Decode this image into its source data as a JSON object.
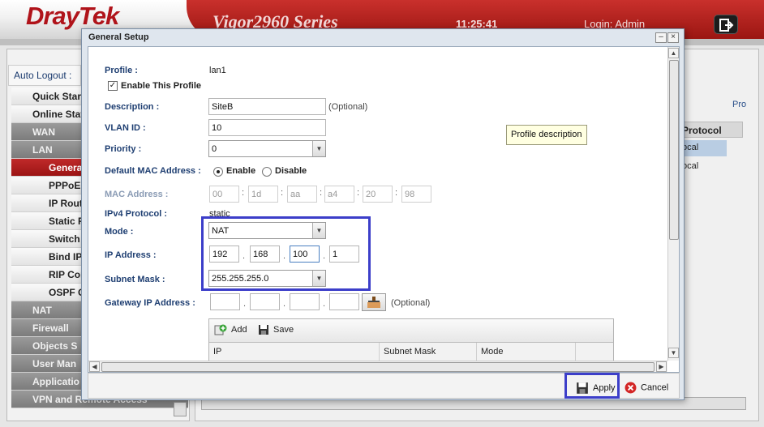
{
  "header": {
    "brand": "DrayTek",
    "model": "Vigor2960 Series",
    "time": "11:25:41",
    "login": "Login: Admin"
  },
  "sidebar": {
    "auto_logout_label": "Auto Logout :",
    "items": [
      {
        "label": "Quick Start",
        "level": 1
      },
      {
        "label": "Online Stat",
        "level": 1
      },
      {
        "label": "WAN",
        "level": 2
      },
      {
        "label": "LAN",
        "level": 2
      },
      {
        "label": "General",
        "level": 3,
        "active": true
      },
      {
        "label": "PPPoE",
        "level": 3
      },
      {
        "label": "IP Rout",
        "level": 3
      },
      {
        "label": "Static R",
        "level": 3
      },
      {
        "label": "Switch",
        "level": 3
      },
      {
        "label": "Bind IP",
        "level": 3
      },
      {
        "label": "RIP Cor",
        "level": 3
      },
      {
        "label": "OSPF C",
        "level": 3
      },
      {
        "label": "NAT",
        "level": 2
      },
      {
        "label": "Firewall",
        "level": 2
      },
      {
        "label": "Objects S",
        "level": 2
      },
      {
        "label": "User Man",
        "level": 2
      },
      {
        "label": "Applicatio",
        "level": 2
      },
      {
        "label": "VPN and Remote Access",
        "level": 2
      }
    ]
  },
  "background_table": {
    "pro_text": "Pro",
    "column": "Protocol",
    "rows": [
      "ocal",
      "ocal"
    ]
  },
  "dialog": {
    "title": "General Setup",
    "profile_label": "Profile :",
    "profile_value": "lan1",
    "enable_profile_label": "Enable This Profile",
    "enable_profile_checked": true,
    "description_label": "Description :",
    "description_value": "SiteB",
    "optional": "(Optional)",
    "vlan_label": "VLAN ID :",
    "vlan_value": "10",
    "priority_label": "Priority :",
    "priority_value": "0",
    "default_mac_label": "Default MAC Address :",
    "enable_label": "Enable",
    "disable_label": "Disable",
    "mac_label": "MAC Address :",
    "mac_octets": [
      "00",
      "1d",
      "aa",
      "a4",
      "20",
      "98"
    ],
    "ipv4_label": "IPv4 Protocol :",
    "ipv4_value": "static",
    "mode_label": "Mode :",
    "mode_value": "NAT",
    "ip_label": "IP Address :",
    "ip_octets": [
      "192",
      "168",
      "100",
      "1"
    ],
    "subnet_label": "Subnet Mask :",
    "subnet_value": "255.255.255.0",
    "gateway_label": "Gateway IP Address :",
    "gateway_octets": [
      "",
      "",
      "",
      ""
    ],
    "tooltip": "Profile description",
    "table": {
      "add_label": "Add",
      "save_label": "Save",
      "columns": [
        "IP",
        "Subnet Mask",
        "Mode"
      ]
    },
    "apply_label": "Apply",
    "cancel_label": "Cancel"
  }
}
